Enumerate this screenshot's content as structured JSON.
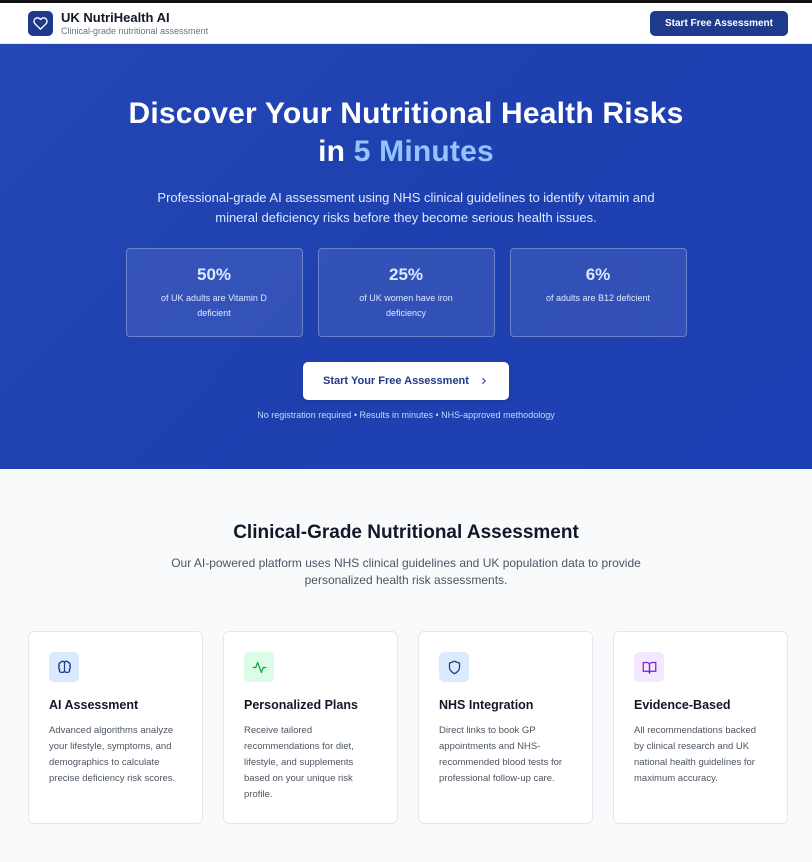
{
  "header": {
    "brand_name": "UK NutriHealth AI",
    "brand_tagline": "Clinical-grade nutritional assessment",
    "cta_label": "Start Free Assessment"
  },
  "hero": {
    "title_line1": "Discover Your Nutritional Health Risks",
    "title_line2_prefix": "in ",
    "title_line2_accent": "5 Minutes",
    "subtitle": "Professional-grade AI assessment using NHS clinical guidelines to identify vitamin and mineral deficiency risks before they become serious health issues.",
    "stats": [
      {
        "value": "50%",
        "label": "of UK adults are Vitamin D deficient"
      },
      {
        "value": "25%",
        "label": "of UK women have iron deficiency"
      },
      {
        "value": "6%",
        "label": "of adults are B12 deficient"
      }
    ],
    "cta_label": "Start Your Free Assessment",
    "fineprint": "No registration required • Results in minutes • NHS-approved methodology"
  },
  "features": {
    "heading": "Clinical-Grade Nutritional Assessment",
    "lead": "Our AI-powered platform uses NHS clinical guidelines and UK population data to provide personalized health risk assessments.",
    "cards": [
      {
        "icon": "brain-icon",
        "title": "AI Assessment",
        "text": "Advanced algorithms analyze your lifestyle, symptoms, and demographics to calculate precise deficiency risk scores."
      },
      {
        "icon": "activity-icon",
        "title": "Personalized Plans",
        "text": "Receive tailored recommendations for diet, lifestyle, and supplements based on your unique risk profile."
      },
      {
        "icon": "shield-icon",
        "title": "NHS Integration",
        "text": "Direct links to book GP appointments and NHS-recommended blood tests for professional follow-up care."
      },
      {
        "icon": "book-icon",
        "title": "Evidence-Based",
        "text": "All recommendations backed by clinical research and UK national health guidelines for maximum accuracy."
      }
    ]
  },
  "colors": {
    "brand": "#1e3a8a",
    "hero_bg": "#1e40af",
    "accent": "#93c5fd",
    "icon_bg_blue": "#dbeafe",
    "icon_bg_green": "#dcfce7",
    "icon_bg_purple": "#f3e8ff"
  }
}
